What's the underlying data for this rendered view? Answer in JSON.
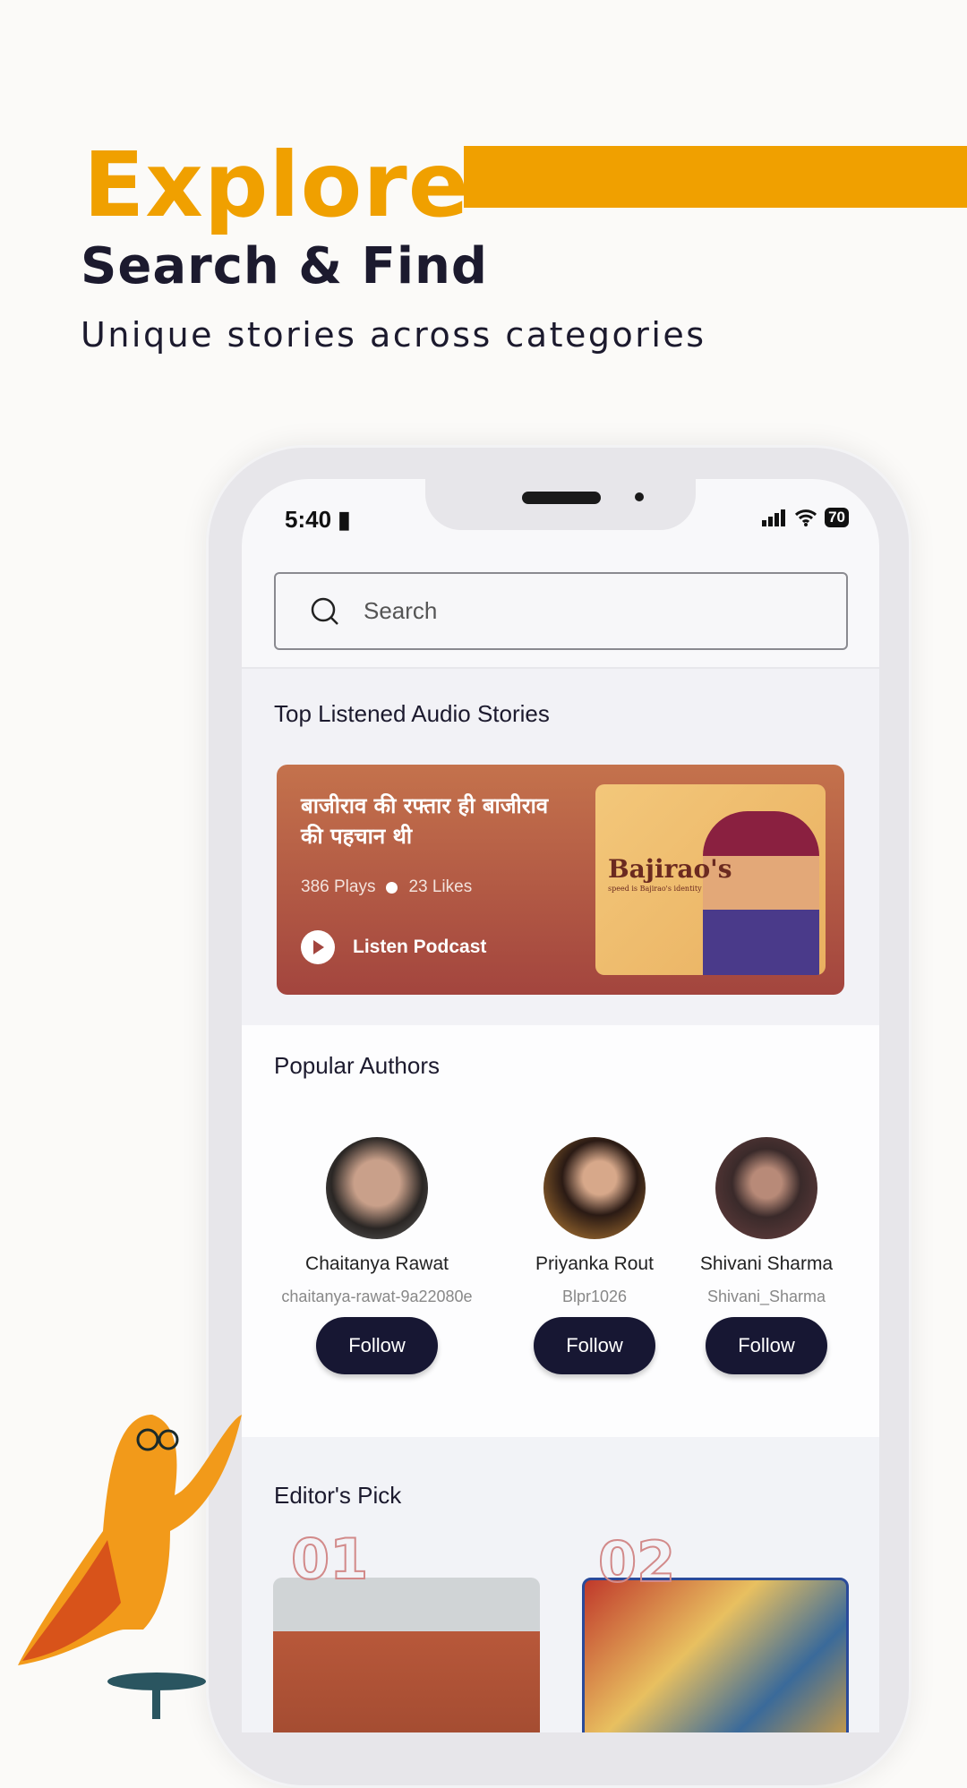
{
  "hero": {
    "title": "Explore",
    "subtitle": "Search & Find",
    "description": "Unique stories across categories",
    "accent": "#F0A000"
  },
  "status_bar": {
    "time": "5:40",
    "battery": "70"
  },
  "search": {
    "placeholder": "Search"
  },
  "top_stories": {
    "title": "Top Listened Audio Stories",
    "card": {
      "title": "बाजीराव की रफ्तार ही बाजीराव की पहचान थी",
      "plays": "386 Plays",
      "likes": "23 Likes",
      "action": "Listen Podcast",
      "image_title": "Bajirao's",
      "image_subtitle": "speed is Bajirao's identity"
    }
  },
  "authors": {
    "title": "Popular Authors",
    "items": [
      {
        "name": "Chaitanya Rawat",
        "handle": "chaitanya-rawat-9a22080e",
        "follow": "Follow"
      },
      {
        "name": "Priyanka Rout",
        "handle": "Blpr1026",
        "follow": "Follow"
      },
      {
        "name": "Shivani Sharma",
        "handle": "Shivani_Sharma",
        "follow": "Follow"
      }
    ]
  },
  "editors_pick": {
    "title": "Editor's Pick",
    "items": [
      {
        "rank": "01"
      },
      {
        "rank": "02"
      }
    ]
  }
}
